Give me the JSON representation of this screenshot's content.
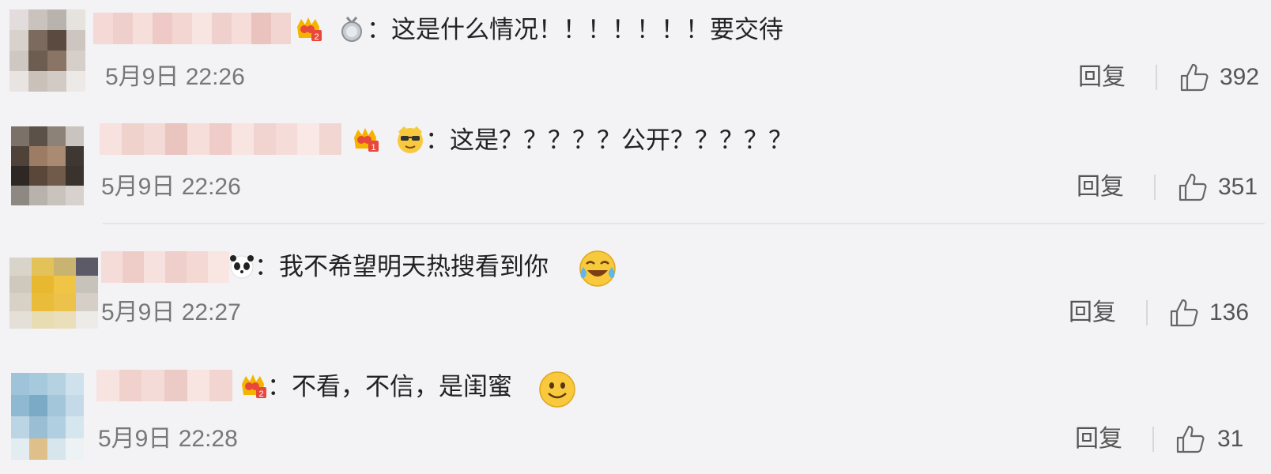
{
  "comments": [
    {
      "text": "：这是什么情况！！！！！！！要交待",
      "time": "5月9日 22:26",
      "reply_label": "回复",
      "likes": "392",
      "badge_level": "2",
      "extra_icon": "medal-icon"
    },
    {
      "text": "：这是？？？？？公开？？？？？",
      "time": "5月9日 22:26",
      "reply_label": "回复",
      "likes": "351",
      "badge_level": "1",
      "extra_icon": "sunglasses-face-icon"
    },
    {
      "text": "：我不希望明天热搜看到你",
      "time": "5月9日 22:27",
      "reply_label": "回复",
      "likes": "136",
      "extra_icon": "panda-icon",
      "trailing_emoji": "laugh-cry-emoji"
    },
    {
      "text": "：不看，不信，是闺蜜",
      "time": "5月9日 22:28",
      "reply_label": "回复",
      "likes": "31",
      "badge_level": "2",
      "trailing_emoji": "smile-emoji"
    }
  ],
  "colors": {
    "background": "#f3f3f5",
    "badge_red": "#e8483b",
    "badge_gold": "#f5b400",
    "emoji_yellow": "#f8c93c"
  }
}
